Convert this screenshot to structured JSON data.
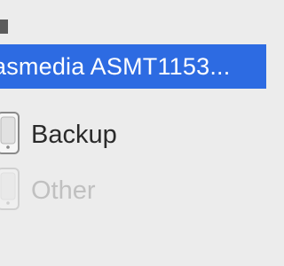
{
  "sidebar": {
    "devices": [
      {
        "label": "asmedia ASMT1153...",
        "icon": "external-drive-icon",
        "selected": true,
        "enabled": true
      },
      {
        "label": "Backup",
        "icon": "external-drive-icon",
        "selected": false,
        "enabled": true
      },
      {
        "label": "Other",
        "icon": "external-drive-icon",
        "selected": false,
        "enabled": false
      }
    ]
  },
  "colors": {
    "selection": "#2d6be2",
    "background": "#ececec",
    "text": "#2a2a2a",
    "disabled_text": "#c0c0c0"
  }
}
